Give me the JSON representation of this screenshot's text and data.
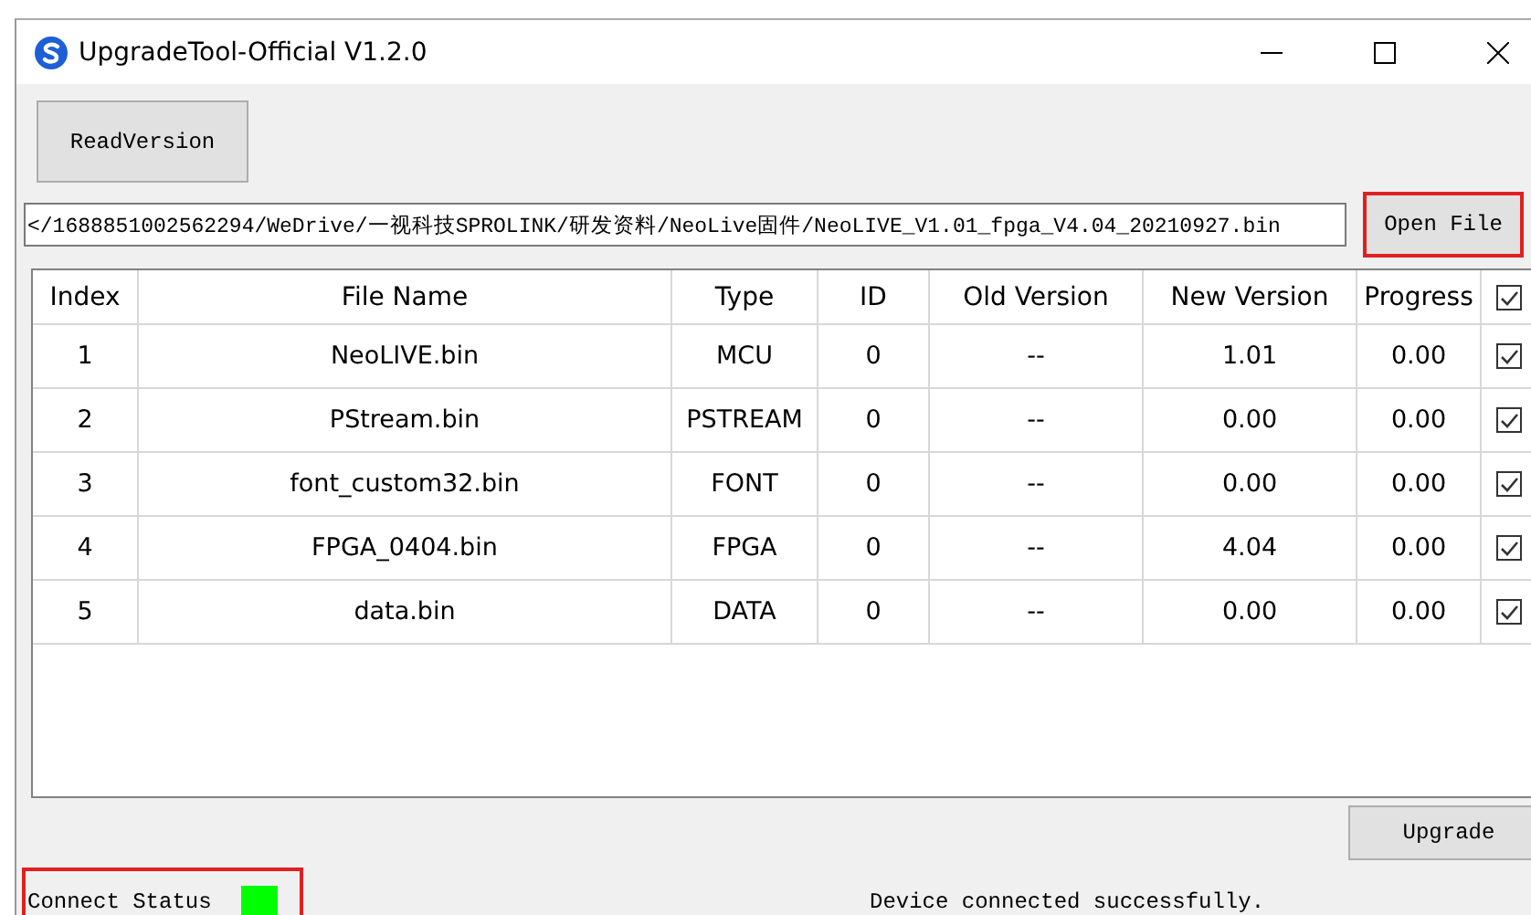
{
  "window": {
    "title": "UpgradeTool-Official V1.2.0"
  },
  "read_button": {
    "label": "ReadVersion"
  },
  "path_field": {
    "value": "</1688851002562294/WeDrive/一视科技SPROLINK/研发资料/NeoLive固件/NeoLIVE_V1.01_fpga_V4.04_20210927.bin"
  },
  "open_button": {
    "label": "Open File",
    "highlighted": true
  },
  "table": {
    "columns": [
      "Index",
      "File Name",
      "Type",
      "ID",
      "Old Version",
      "New Version",
      "Progress"
    ],
    "all_checked": true,
    "rows": [
      {
        "cells": [
          "1",
          "NeoLIVE.bin",
          "MCU",
          "0",
          "--",
          "1.01",
          "0.00"
        ],
        "checked": true
      },
      {
        "cells": [
          "2",
          "PStream.bin",
          "PSTREAM",
          "0",
          "--",
          "0.00",
          "0.00"
        ],
        "checked": true
      },
      {
        "cells": [
          "3",
          "font_custom32.bin",
          "FONT",
          "0",
          "--",
          "0.00",
          "0.00"
        ],
        "checked": true
      },
      {
        "cells": [
          "4",
          "FPGA_0404.bin",
          "FPGA",
          "0",
          "--",
          "4.04",
          "0.00"
        ],
        "checked": true
      },
      {
        "cells": [
          "5",
          "data.bin",
          "DATA",
          "0",
          "--",
          "0.00",
          "0.00"
        ],
        "checked": true
      }
    ]
  },
  "upgrade_button": {
    "label": "Upgrade"
  },
  "status_bar": {
    "label": "Connect Status",
    "color": "#00ff00",
    "highlighted": true,
    "message": "Device connected successfully."
  }
}
